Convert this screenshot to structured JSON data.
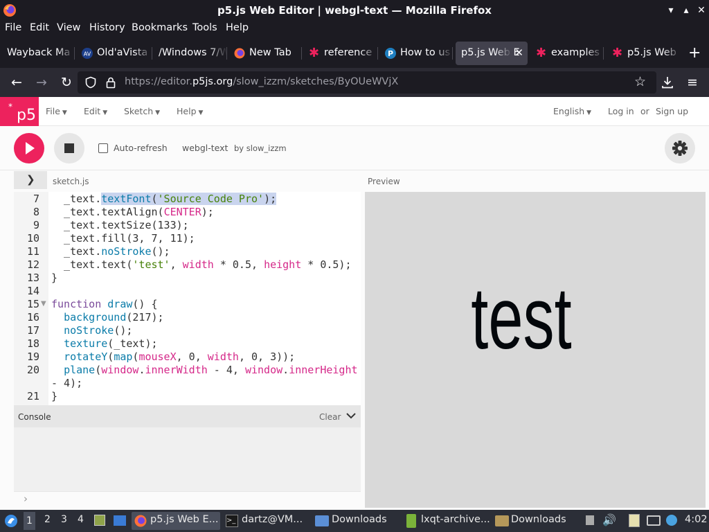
{
  "window": {
    "title": "p5.js Web Editor | webgl-text — Mozilla Firefox"
  },
  "menubar": [
    "File",
    "Edit",
    "View",
    "History",
    "Bookmarks",
    "Tools",
    "Help"
  ],
  "tabs": [
    {
      "label": "Wayback Ma",
      "active": false
    },
    {
      "label": "Old'aVista",
      "active": false
    },
    {
      "label": "/Windows 7/W",
      "active": false
    },
    {
      "label": "New Tab",
      "active": false
    },
    {
      "label": "reference",
      "active": false
    },
    {
      "label": "How to us",
      "active": false
    },
    {
      "label": "p5.js Web E",
      "active": true
    },
    {
      "label": "examples",
      "active": false
    },
    {
      "label": "p5.js Web",
      "active": false
    }
  ],
  "navbar": {
    "url_prefix": "https://editor.",
    "url_domain": "p5js.org",
    "url_path": "/slow_izzm/sketches/ByOUeWVjX"
  },
  "p5nav": {
    "logo": "p5",
    "logo_sup": "*",
    "menu": [
      "File",
      "Edit",
      "Sketch",
      "Help"
    ],
    "language": "English",
    "login": "Log in",
    "or": "or",
    "signup": "Sign up"
  },
  "toolbar": {
    "autorefresh": "Auto-refresh",
    "sketch_name": "webgl-text",
    "author": "by slow_izzm"
  },
  "editor": {
    "filename": "sketch.js",
    "preview_label": "Preview",
    "line_numbers": [
      "7",
      "8",
      "9",
      "10",
      "11",
      "12",
      "13",
      "14",
      "15",
      "16",
      "17",
      "18",
      "19",
      "20",
      "21"
    ],
    "lines": [
      "  _text.textFont('Source Code Pro');",
      "  _text.textAlign(CENTER);",
      "  _text.textSize(133);",
      "  _text.fill(3, 7, 11);",
      "  _text.noStroke();",
      "  _text.text('test', width * 0.5, height * 0.5);",
      "}",
      "",
      "function draw() {",
      "  background(217);",
      "  noStroke();",
      "  texture(_text);",
      "  rotateY(map(mouseX, 0, width, 0, 3));",
      "  plane(window.innerWidth - 4, window.innerHeight",
      "- 4);",
      "}"
    ]
  },
  "console": {
    "title": "Console",
    "clear": "Clear",
    "prompt": "›"
  },
  "preview": {
    "text": "test",
    "background": "#d9d9d9",
    "text_color": "#03070b"
  },
  "taskbar": {
    "workspaces": [
      "1",
      "2",
      "3",
      "4"
    ],
    "apps": [
      {
        "label": "p5.js Web E...",
        "active": true
      },
      {
        "label": "dartz@VM...",
        "active": false
      },
      {
        "label": "Downloads",
        "active": false
      },
      {
        "label": "lxqt-archive...",
        "active": false
      },
      {
        "label": "Downloads",
        "active": false
      }
    ],
    "clock": "4:02"
  },
  "colors": {
    "accent": "#ed225d",
    "firefox_dark": "#1c1b22"
  }
}
